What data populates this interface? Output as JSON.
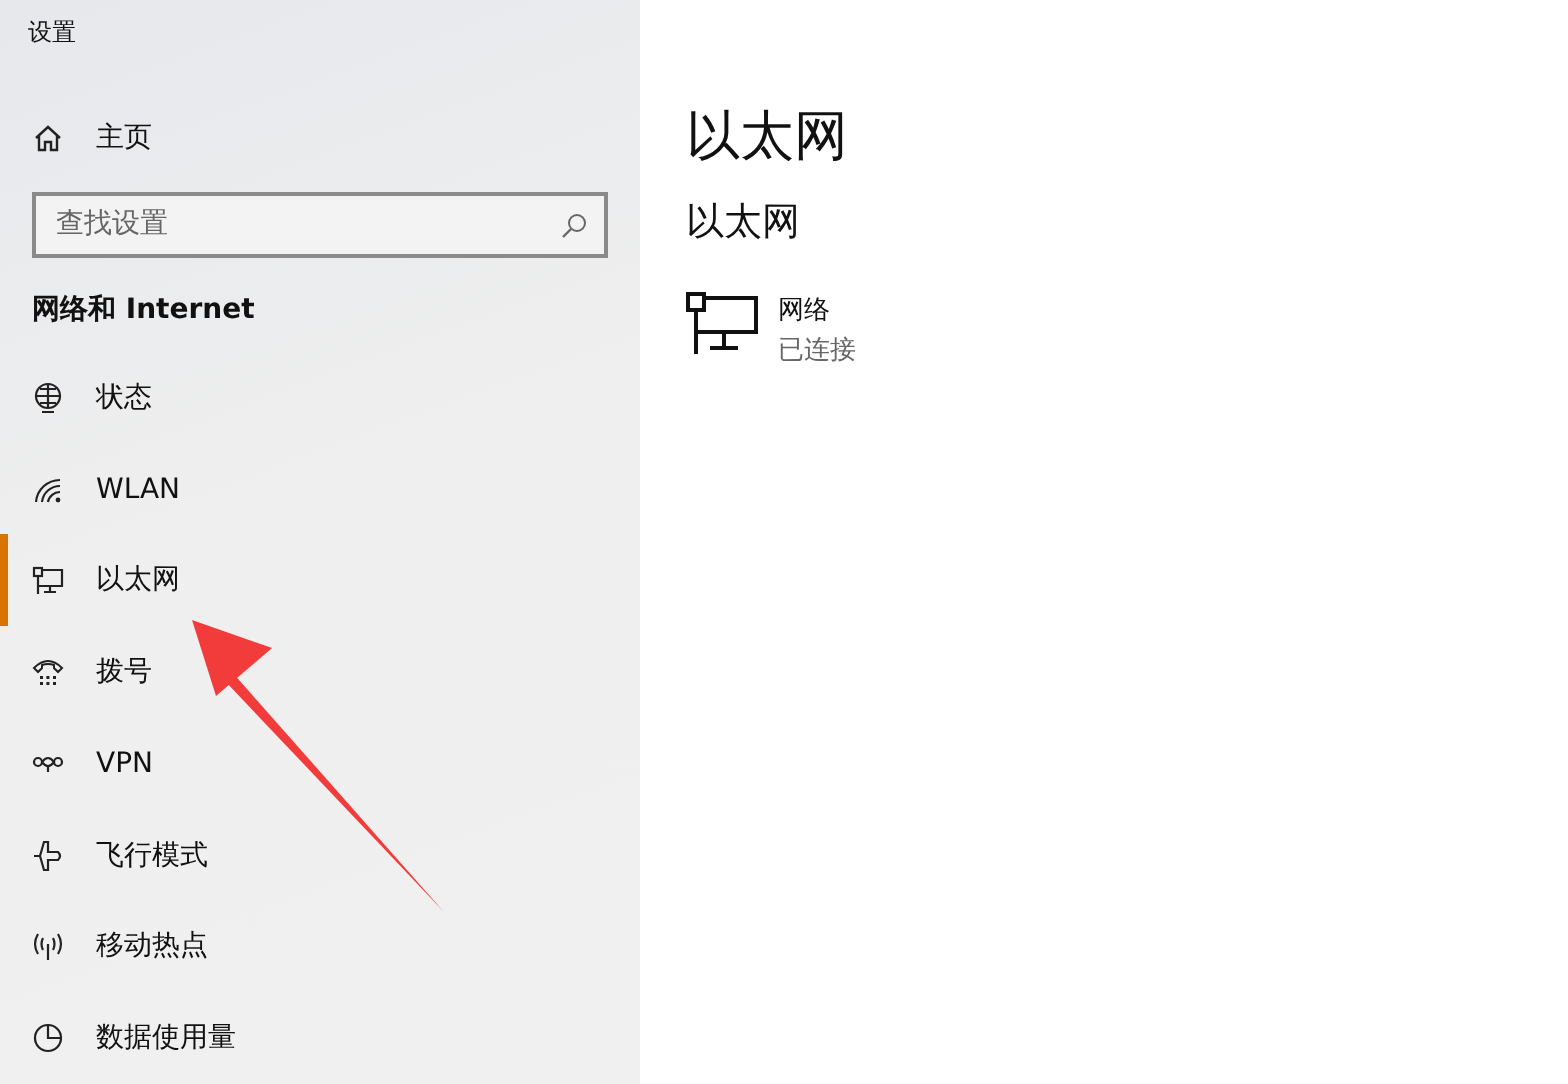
{
  "window": {
    "title": "设置"
  },
  "sidebar": {
    "home": {
      "label": "主页"
    },
    "search": {
      "placeholder": "查找设置"
    },
    "section_title": "网络和 Internet",
    "items": [
      {
        "label": "状态",
        "kind": "status",
        "selected": false
      },
      {
        "label": "WLAN",
        "kind": "wifi",
        "selected": false
      },
      {
        "label": "以太网",
        "kind": "ethernet",
        "selected": true
      },
      {
        "label": "拨号",
        "kind": "dialup",
        "selected": false
      },
      {
        "label": "VPN",
        "kind": "vpn",
        "selected": false
      },
      {
        "label": "飞行模式",
        "kind": "airplane",
        "selected": false
      },
      {
        "label": "移动热点",
        "kind": "hotspot",
        "selected": false
      },
      {
        "label": "数据使用量",
        "kind": "data",
        "selected": false
      }
    ]
  },
  "content": {
    "title": "以太网",
    "subtitle": "以太网",
    "network": {
      "name": "网络",
      "status": "已连接"
    }
  }
}
